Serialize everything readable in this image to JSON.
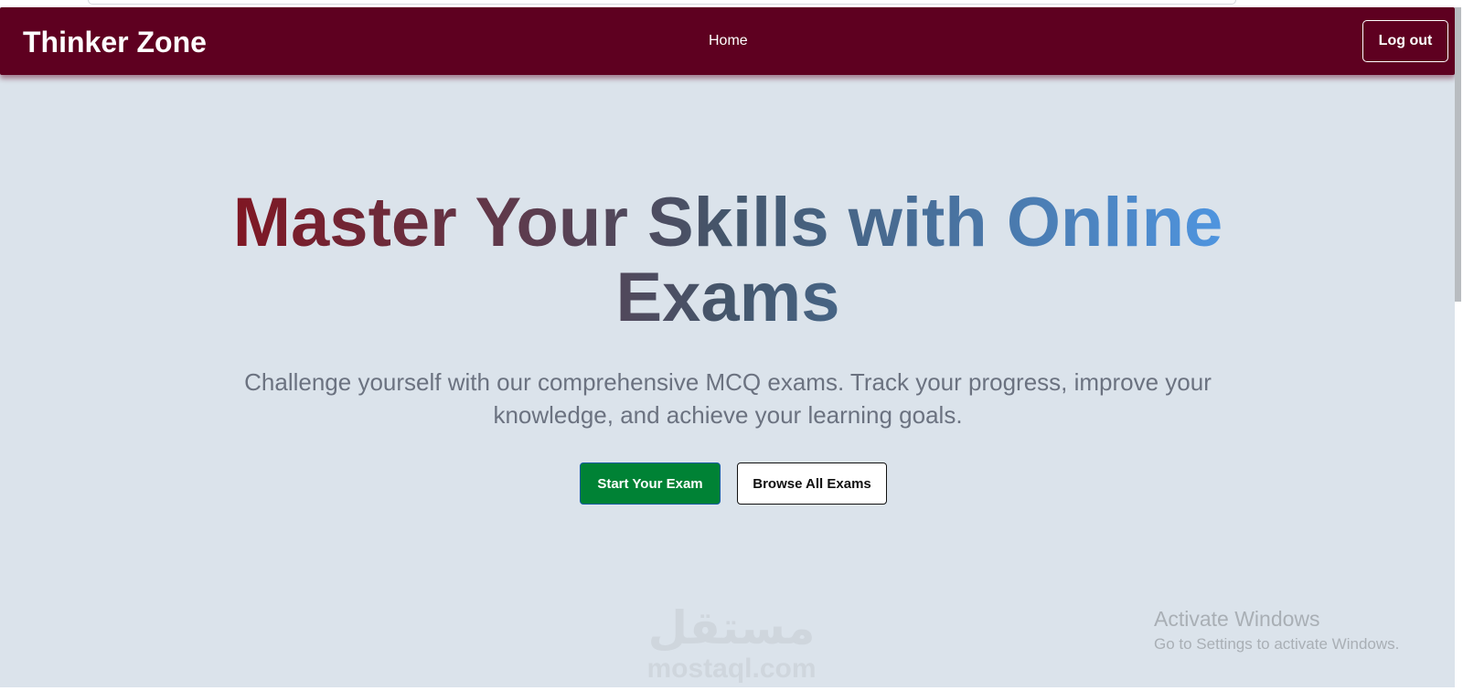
{
  "navbar": {
    "brand": "Thinker Zone",
    "links": [
      {
        "label": "Home"
      }
    ],
    "logout_label": "Log out",
    "background_color": "#5e0020"
  },
  "hero": {
    "title": "Master Your Skills with Online Exams",
    "title_gradient_colors": [
      "#8b0a15",
      "#44566b",
      "#51a1f6"
    ],
    "subtitle": "Challenge yourself with our comprehensive MCQ exams. Track your progress, improve your knowledge, and achieve your learning goals.",
    "primary_button": "Start Your Exam",
    "secondary_button": "Browse All Exams",
    "primary_button_color": "#008235"
  },
  "watermark": {
    "arabic": "مستقل",
    "latin": "mostaql.com"
  },
  "os_overlay": {
    "title": "Activate Windows",
    "subtitle": "Go to Settings to activate Windows."
  },
  "page_background": "#dbe3eb"
}
